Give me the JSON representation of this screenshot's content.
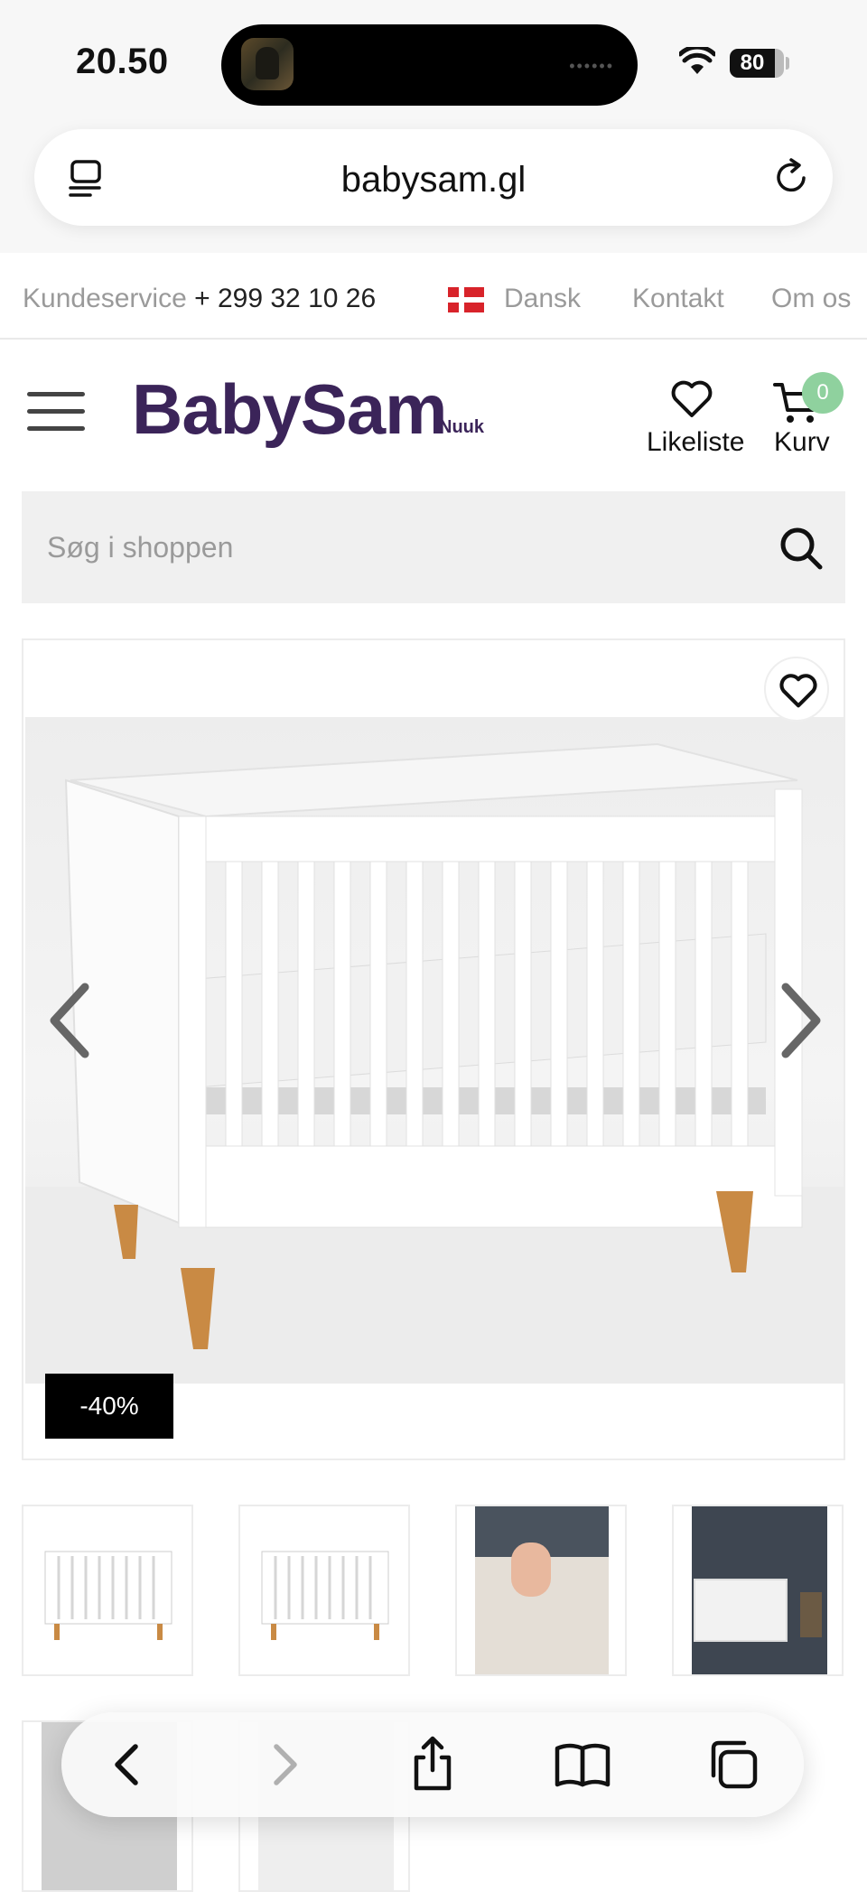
{
  "status_bar": {
    "time": "20.50",
    "battery": "80"
  },
  "browser": {
    "url": "babysam.gl"
  },
  "topline": {
    "customer_service_label": "Kundeservice",
    "phone": "+ 299 32 10 26",
    "language": "Dansk",
    "contact": "Kontakt",
    "about": "Om os"
  },
  "header": {
    "logo": "BabySam",
    "logo_sub": "Nuuk",
    "wishlist_label": "Likeliste",
    "cart_label": "Kurv",
    "cart_count": "0"
  },
  "search": {
    "placeholder": "Søg i shoppen"
  },
  "product": {
    "discount_badge": "-40%",
    "thumbnails": [
      "crib-white",
      "crib-white",
      "child-in-crib",
      "crib-dark-wall"
    ]
  },
  "colors": {
    "brand": "#3b2459",
    "cart_badge": "#8fd19e",
    "discount_bg": "#000000",
    "danish_flag_red": "#d8232a"
  },
  "icons": [
    "reader-icon",
    "reload-icon",
    "menu-icon",
    "heart-icon",
    "cart-icon",
    "search-icon",
    "chevron-left-icon",
    "chevron-right-icon",
    "back-icon",
    "forward-icon",
    "share-icon",
    "bookmarks-icon",
    "tabs-icon"
  ]
}
